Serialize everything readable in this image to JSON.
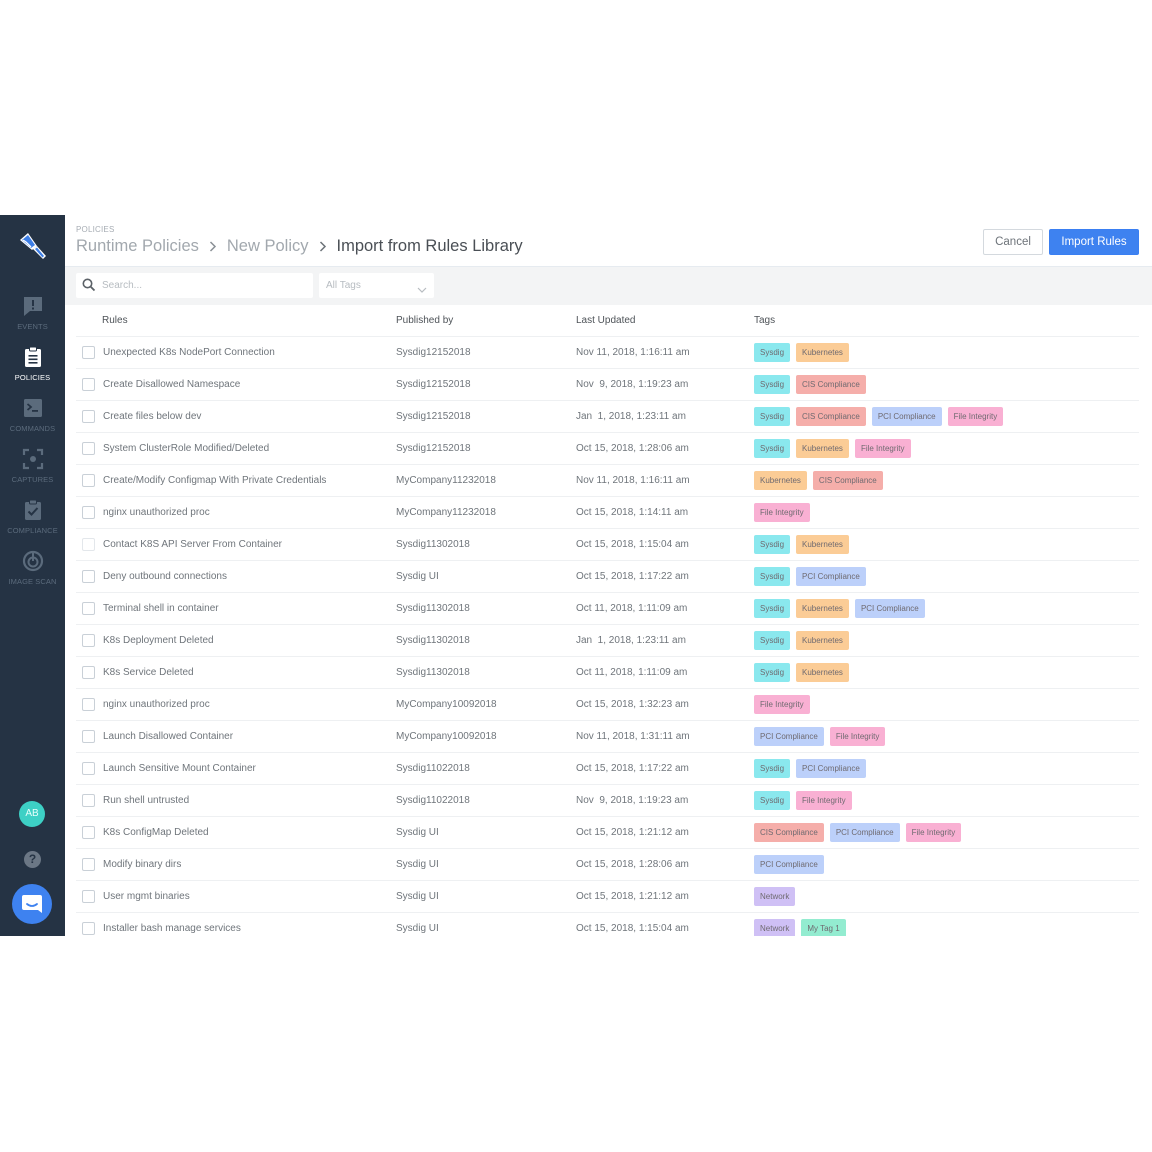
{
  "sidebar": {
    "logo_icon": "trowel-logo-icon",
    "items": [
      {
        "label": "EVENTS",
        "icon": "event-alert-icon",
        "active": false
      },
      {
        "label": "POLICIES",
        "icon": "clipboard-icon",
        "active": true
      },
      {
        "label": "COMMANDS",
        "icon": "terminal-icon",
        "active": false
      },
      {
        "label": "CAPTURES",
        "icon": "capture-icon",
        "active": false
      },
      {
        "label": "COMPLIANCE",
        "icon": "clipboard-check-icon",
        "active": false
      },
      {
        "label": "IMAGE SCAN",
        "icon": "scan-icon",
        "active": false
      }
    ],
    "avatar_initials": "AB",
    "help_glyph": "?",
    "chat_icon": "chat-icon"
  },
  "header": {
    "section": "POLICIES",
    "breadcrumbs": [
      "Runtime Policies",
      "New Policy",
      "Import from Rules Library"
    ],
    "separator": "›",
    "cancel_label": "Cancel",
    "import_label": "Import Rules"
  },
  "toolbar": {
    "search_placeholder": "Search...",
    "tags_filter_value": "All Tags"
  },
  "tag_colors": {
    "Sysdig": "#8ae8ee",
    "Kubernetes": "#fbcc96",
    "CIS Compliance": "#f5aeaa",
    "PCI Compliance": "#bcd0fa",
    "File Integrity": "#f9b0d3",
    "Network": "#cfc0f5",
    "My Tag 1": "#93ecd0"
  },
  "table": {
    "columns": [
      "Rules",
      "Published by",
      "Last Updated",
      "Tags"
    ],
    "rows": [
      {
        "rule": "Unexpected K8s NodePort Connection",
        "published_by": "Sysdig12152018",
        "updated": "Nov 11, 2018, 1:16:11 am",
        "tags": [
          "Sysdig",
          "Kubernetes"
        ]
      },
      {
        "rule": "Create Disallowed Namespace",
        "published_by": "Sysdig12152018",
        "updated": "Nov  9, 2018, 1:19:23 am",
        "tags": [
          "Sysdig",
          "CIS Compliance"
        ]
      },
      {
        "rule": "Create files below dev",
        "published_by": "Sysdig12152018",
        "updated": "Jan  1, 2018, 1:23:11 am",
        "tags": [
          "Sysdig",
          "CIS Compliance",
          "PCI Compliance",
          "File Integrity"
        ]
      },
      {
        "rule": "System ClusterRole Modified/Deleted",
        "published_by": "Sysdig12152018",
        "updated": "Oct 15, 2018, 1:28:06 am",
        "tags": [
          "Sysdig",
          "Kubernetes",
          "File Integrity"
        ]
      },
      {
        "rule": "Create/Modify Configmap With Private Credentials",
        "published_by": "MyCompany11232018",
        "updated": "Nov 11, 2018, 1:16:11 am",
        "tags": [
          "Kubernetes",
          "CIS Compliance"
        ]
      },
      {
        "rule": "nginx unauthorized proc",
        "published_by": "MyCompany11232018",
        "updated": "Oct 15, 2018, 1:14:11 am",
        "tags": [
          "File Integrity"
        ]
      },
      {
        "rule": "Contact K8S API Server From Container",
        "published_by": "Sysdig11302018",
        "updated": "Oct 15, 2018, 1:15:04 am",
        "tags": [
          "Sysdig",
          "Kubernetes"
        ],
        "faint_checkbox": true
      },
      {
        "rule": "Deny outbound connections",
        "published_by": "Sysdig UI",
        "updated": "Oct 15, 2018, 1:17:22 am",
        "tags": [
          "Sysdig",
          "PCI Compliance"
        ]
      },
      {
        "rule": "Terminal shell in container",
        "published_by": "Sysdig11302018",
        "updated": "Oct 11, 2018, 1:11:09 am",
        "tags": [
          "Sysdig",
          "Kubernetes",
          "PCI Compliance"
        ]
      },
      {
        "rule": "K8s Deployment Deleted",
        "published_by": "Sysdig11302018",
        "updated": "Jan  1, 2018, 1:23:11 am",
        "tags": [
          "Sysdig",
          "Kubernetes"
        ]
      },
      {
        "rule": "K8s Service Deleted",
        "published_by": "Sysdig11302018",
        "updated": "Oct 11, 2018, 1:11:09 am",
        "tags": [
          "Sysdig",
          "Kubernetes"
        ]
      },
      {
        "rule": "nginx unauthorized proc",
        "published_by": "MyCompany10092018",
        "updated": "Oct 15, 2018, 1:32:23 am",
        "tags": [
          "File Integrity"
        ]
      },
      {
        "rule": "Launch Disallowed Container",
        "published_by": "MyCompany10092018",
        "updated": "Nov 11, 2018, 1:31:11 am",
        "tags": [
          "PCI Compliance",
          "File Integrity"
        ]
      },
      {
        "rule": "Launch Sensitive Mount Container",
        "published_by": "Sysdig11022018",
        "updated": "Oct 15, 2018, 1:17:22 am",
        "tags": [
          "Sysdig",
          "PCI Compliance"
        ]
      },
      {
        "rule": "Run shell untrusted",
        "published_by": "Sysdig11022018",
        "updated": "Nov  9, 2018, 1:19:23 am",
        "tags": [
          "Sysdig",
          "File Integrity"
        ]
      },
      {
        "rule": "K8s ConfigMap Deleted",
        "published_by": "Sysdig UI",
        "updated": "Oct 15, 2018, 1:21:12 am",
        "tags": [
          "CIS Compliance",
          "PCI Compliance",
          "File Integrity"
        ]
      },
      {
        "rule": "Modify binary dirs",
        "published_by": "Sysdig UI",
        "updated": "Oct 15, 2018, 1:28:06 am",
        "tags": [
          "PCI Compliance"
        ]
      },
      {
        "rule": "User mgmt binaries",
        "published_by": "Sysdig UI",
        "updated": "Oct 15, 2018, 1:21:12 am",
        "tags": [
          "Network"
        ]
      },
      {
        "rule": "Installer bash manage services",
        "published_by": "Sysdig UI",
        "updated": "Oct 15, 2018, 1:15:04 am",
        "tags": [
          "Network",
          "My Tag 1"
        ]
      }
    ]
  }
}
